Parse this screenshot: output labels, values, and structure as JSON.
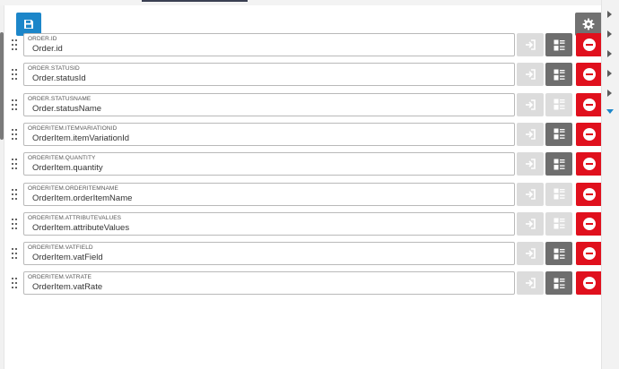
{
  "toolbar": {
    "save_icon": "floppy-disk-icon",
    "settings_icon": "gear-icon"
  },
  "rows": [
    {
      "label": "ORDER.ID",
      "value": "Order.id",
      "calc_active": true
    },
    {
      "label": "ORDER.STATUSID",
      "value": "Order.statusId",
      "calc_active": true
    },
    {
      "label": "ORDER.STATUSNAME",
      "value": "Order.statusName",
      "calc_active": false
    },
    {
      "label": "ORDERITEM.ITEMVARIATIONID",
      "value": "OrderItem.itemVariationId",
      "calc_active": true
    },
    {
      "label": "ORDERITEM.QUANTITY",
      "value": "OrderItem.quantity",
      "calc_active": true
    },
    {
      "label": "ORDERITEM.ORDERITEMNAME",
      "value": "OrderItem.orderItemName",
      "calc_active": false
    },
    {
      "label": "ORDERITEM.ATTRIBUTEVALUES",
      "value": "OrderItem.attributeValues",
      "calc_active": false
    },
    {
      "label": "ORDERITEM.VATFIELD",
      "value": "OrderItem.vatField",
      "calc_active": true
    },
    {
      "label": "ORDERITEM.VATRATE",
      "value": "OrderItem.vatRate",
      "calc_active": true
    }
  ],
  "colors": {
    "primary": "#1c86c9",
    "danger": "#e0101d",
    "neutral_dark": "#6e6e6e",
    "neutral_light": "#dcdcdc"
  }
}
